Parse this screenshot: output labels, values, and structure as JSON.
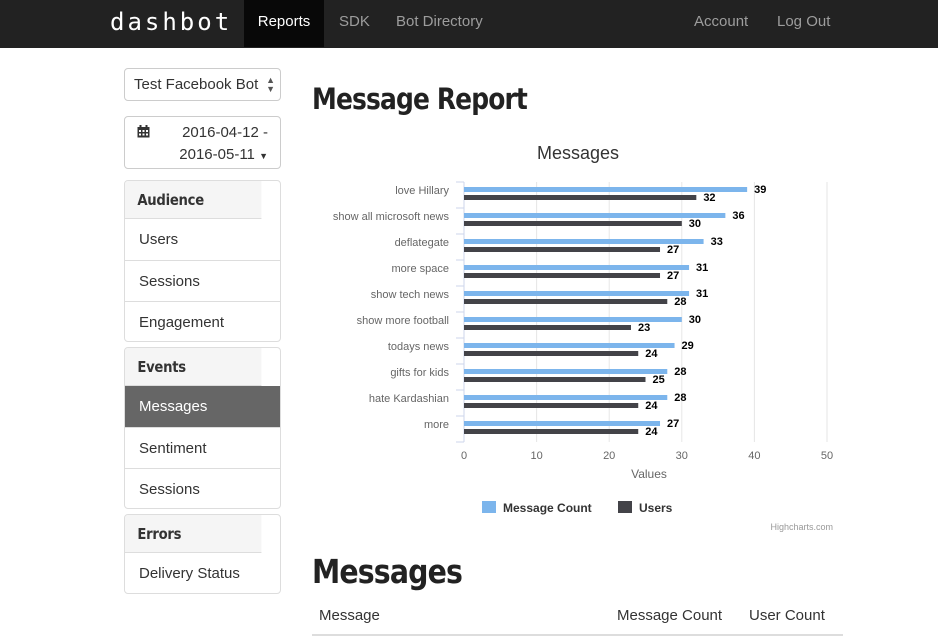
{
  "navbar": {
    "brand": "dashbot",
    "items": [
      {
        "label": "Reports",
        "active": true
      },
      {
        "label": "SDK"
      },
      {
        "label": "Bot Directory"
      }
    ],
    "right_items": [
      {
        "label": "Account"
      },
      {
        "label": "Log Out"
      }
    ]
  },
  "sidebar": {
    "bot_select": {
      "value": "Test Facebook Bot"
    },
    "date_range": {
      "start": "2016-04-12 -",
      "end": "2016-05-11",
      "icon": "calendar-icon"
    },
    "panels": [
      {
        "heading": "Audience",
        "items": [
          {
            "label": "Users"
          },
          {
            "label": "Sessions"
          },
          {
            "label": "Engagement"
          }
        ]
      },
      {
        "heading": "Events",
        "items": [
          {
            "label": "Messages",
            "active": true
          },
          {
            "label": "Sentiment"
          },
          {
            "label": "Sessions"
          }
        ]
      },
      {
        "heading": "Errors",
        "items": [
          {
            "label": "Delivery Status"
          }
        ]
      }
    ]
  },
  "main": {
    "title": "Message Report",
    "section_title": "Messages",
    "table": {
      "headers": [
        "Message",
        "Message Count",
        "User Count"
      ]
    }
  },
  "chart_data": {
    "type": "bar",
    "orientation": "horizontal",
    "title": "Messages",
    "xlabel": "Values",
    "categories": [
      "love Hillary",
      "show all microsoft news",
      "deflategate",
      "more space",
      "show tech news",
      "show more football",
      "todays news",
      "gifts for kids",
      "hate Kardashian",
      "more"
    ],
    "series": [
      {
        "name": "Message Count",
        "color": "#7cb5ec",
        "values": [
          39,
          36,
          33,
          31,
          31,
          30,
          29,
          28,
          28,
          27
        ]
      },
      {
        "name": "Users",
        "color": "#434348",
        "values": [
          32,
          30,
          27,
          27,
          28,
          23,
          24,
          25,
          24,
          24
        ]
      }
    ],
    "xlim": [
      0,
      50
    ],
    "ticks": [
      0,
      10,
      20,
      30,
      40,
      50
    ],
    "grid": true,
    "legend": "bottom-center",
    "credits": "Highcharts.com"
  }
}
